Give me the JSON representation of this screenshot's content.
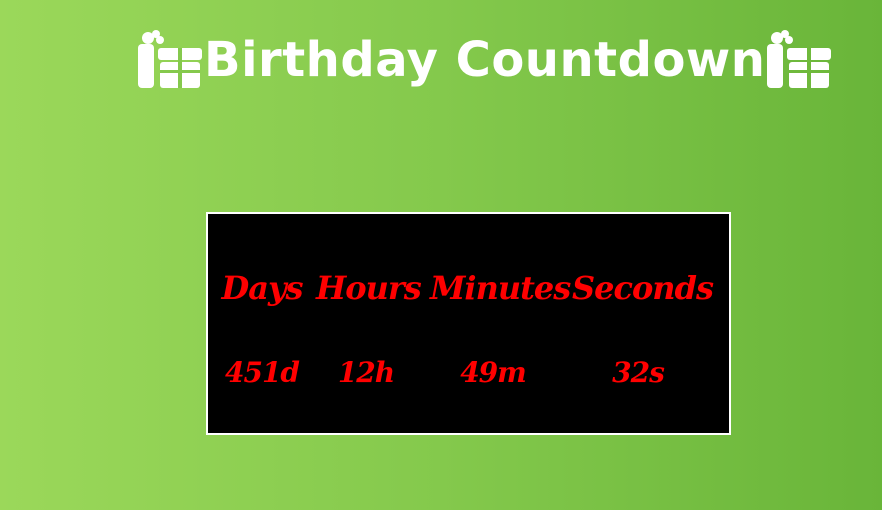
{
  "header": {
    "title": "Birthday Countdown",
    "left_icon": "gift-icon",
    "right_icon": "gift-icon"
  },
  "countdown": {
    "labels": [
      "Days",
      "Hours",
      "Minutes",
      "Seconds"
    ],
    "values": [
      "451d",
      "12h",
      "49m",
      "32s"
    ]
  },
  "colors": {
    "background_start": "#9bd85a",
    "background_end": "#69b539",
    "panel": "#000000",
    "panel_border": "#ffffff",
    "accent_text": "#ff0000",
    "title_text": "#ffffff"
  }
}
